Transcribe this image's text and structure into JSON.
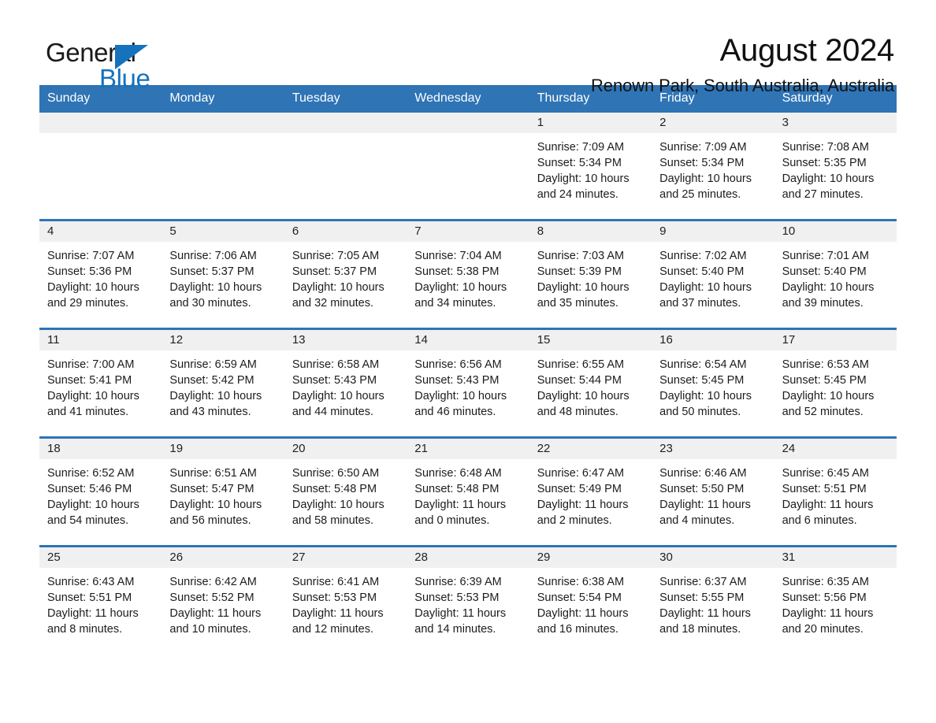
{
  "brand": {
    "name_part1": "General",
    "name_part2": "Blue",
    "triangle_color": "#1573bd"
  },
  "header": {
    "title": "August 2024",
    "subtitle": "Renown Park, South Australia, Australia"
  },
  "theme": {
    "header_blue": "#2f74b5",
    "date_band_gray": "#f0f0f0",
    "text_color": "#1c1c1c"
  },
  "calendar": {
    "weekdays": [
      "Sunday",
      "Monday",
      "Tuesday",
      "Wednesday",
      "Thursday",
      "Friday",
      "Saturday"
    ],
    "weeks": [
      [
        {
          "day": "",
          "lines": []
        },
        {
          "day": "",
          "lines": []
        },
        {
          "day": "",
          "lines": []
        },
        {
          "day": "",
          "lines": []
        },
        {
          "day": "1",
          "lines": [
            "Sunrise: 7:09 AM",
            "Sunset: 5:34 PM",
            "Daylight: 10 hours",
            "and 24 minutes."
          ]
        },
        {
          "day": "2",
          "lines": [
            "Sunrise: 7:09 AM",
            "Sunset: 5:34 PM",
            "Daylight: 10 hours",
            "and 25 minutes."
          ]
        },
        {
          "day": "3",
          "lines": [
            "Sunrise: 7:08 AM",
            "Sunset: 5:35 PM",
            "Daylight: 10 hours",
            "and 27 minutes."
          ]
        }
      ],
      [
        {
          "day": "4",
          "lines": [
            "Sunrise: 7:07 AM",
            "Sunset: 5:36 PM",
            "Daylight: 10 hours",
            "and 29 minutes."
          ]
        },
        {
          "day": "5",
          "lines": [
            "Sunrise: 7:06 AM",
            "Sunset: 5:37 PM",
            "Daylight: 10 hours",
            "and 30 minutes."
          ]
        },
        {
          "day": "6",
          "lines": [
            "Sunrise: 7:05 AM",
            "Sunset: 5:37 PM",
            "Daylight: 10 hours",
            "and 32 minutes."
          ]
        },
        {
          "day": "7",
          "lines": [
            "Sunrise: 7:04 AM",
            "Sunset: 5:38 PM",
            "Daylight: 10 hours",
            "and 34 minutes."
          ]
        },
        {
          "day": "8",
          "lines": [
            "Sunrise: 7:03 AM",
            "Sunset: 5:39 PM",
            "Daylight: 10 hours",
            "and 35 minutes."
          ]
        },
        {
          "day": "9",
          "lines": [
            "Sunrise: 7:02 AM",
            "Sunset: 5:40 PM",
            "Daylight: 10 hours",
            "and 37 minutes."
          ]
        },
        {
          "day": "10",
          "lines": [
            "Sunrise: 7:01 AM",
            "Sunset: 5:40 PM",
            "Daylight: 10 hours",
            "and 39 minutes."
          ]
        }
      ],
      [
        {
          "day": "11",
          "lines": [
            "Sunrise: 7:00 AM",
            "Sunset: 5:41 PM",
            "Daylight: 10 hours",
            "and 41 minutes."
          ]
        },
        {
          "day": "12",
          "lines": [
            "Sunrise: 6:59 AM",
            "Sunset: 5:42 PM",
            "Daylight: 10 hours",
            "and 43 minutes."
          ]
        },
        {
          "day": "13",
          "lines": [
            "Sunrise: 6:58 AM",
            "Sunset: 5:43 PM",
            "Daylight: 10 hours",
            "and 44 minutes."
          ]
        },
        {
          "day": "14",
          "lines": [
            "Sunrise: 6:56 AM",
            "Sunset: 5:43 PM",
            "Daylight: 10 hours",
            "and 46 minutes."
          ]
        },
        {
          "day": "15",
          "lines": [
            "Sunrise: 6:55 AM",
            "Sunset: 5:44 PM",
            "Daylight: 10 hours",
            "and 48 minutes."
          ]
        },
        {
          "day": "16",
          "lines": [
            "Sunrise: 6:54 AM",
            "Sunset: 5:45 PM",
            "Daylight: 10 hours",
            "and 50 minutes."
          ]
        },
        {
          "day": "17",
          "lines": [
            "Sunrise: 6:53 AM",
            "Sunset: 5:45 PM",
            "Daylight: 10 hours",
            "and 52 minutes."
          ]
        }
      ],
      [
        {
          "day": "18",
          "lines": [
            "Sunrise: 6:52 AM",
            "Sunset: 5:46 PM",
            "Daylight: 10 hours",
            "and 54 minutes."
          ]
        },
        {
          "day": "19",
          "lines": [
            "Sunrise: 6:51 AM",
            "Sunset: 5:47 PM",
            "Daylight: 10 hours",
            "and 56 minutes."
          ]
        },
        {
          "day": "20",
          "lines": [
            "Sunrise: 6:50 AM",
            "Sunset: 5:48 PM",
            "Daylight: 10 hours",
            "and 58 minutes."
          ]
        },
        {
          "day": "21",
          "lines": [
            "Sunrise: 6:48 AM",
            "Sunset: 5:48 PM",
            "Daylight: 11 hours",
            "and 0 minutes."
          ]
        },
        {
          "day": "22",
          "lines": [
            "Sunrise: 6:47 AM",
            "Sunset: 5:49 PM",
            "Daylight: 11 hours",
            "and 2 minutes."
          ]
        },
        {
          "day": "23",
          "lines": [
            "Sunrise: 6:46 AM",
            "Sunset: 5:50 PM",
            "Daylight: 11 hours",
            "and 4 minutes."
          ]
        },
        {
          "day": "24",
          "lines": [
            "Sunrise: 6:45 AM",
            "Sunset: 5:51 PM",
            "Daylight: 11 hours",
            "and 6 minutes."
          ]
        }
      ],
      [
        {
          "day": "25",
          "lines": [
            "Sunrise: 6:43 AM",
            "Sunset: 5:51 PM",
            "Daylight: 11 hours",
            "and 8 minutes."
          ]
        },
        {
          "day": "26",
          "lines": [
            "Sunrise: 6:42 AM",
            "Sunset: 5:52 PM",
            "Daylight: 11 hours",
            "and 10 minutes."
          ]
        },
        {
          "day": "27",
          "lines": [
            "Sunrise: 6:41 AM",
            "Sunset: 5:53 PM",
            "Daylight: 11 hours",
            "and 12 minutes."
          ]
        },
        {
          "day": "28",
          "lines": [
            "Sunrise: 6:39 AM",
            "Sunset: 5:53 PM",
            "Daylight: 11 hours",
            "and 14 minutes."
          ]
        },
        {
          "day": "29",
          "lines": [
            "Sunrise: 6:38 AM",
            "Sunset: 5:54 PM",
            "Daylight: 11 hours",
            "and 16 minutes."
          ]
        },
        {
          "day": "30",
          "lines": [
            "Sunrise: 6:37 AM",
            "Sunset: 5:55 PM",
            "Daylight: 11 hours",
            "and 18 minutes."
          ]
        },
        {
          "day": "31",
          "lines": [
            "Sunrise: 6:35 AM",
            "Sunset: 5:56 PM",
            "Daylight: 11 hours",
            "and 20 minutes."
          ]
        }
      ]
    ]
  }
}
